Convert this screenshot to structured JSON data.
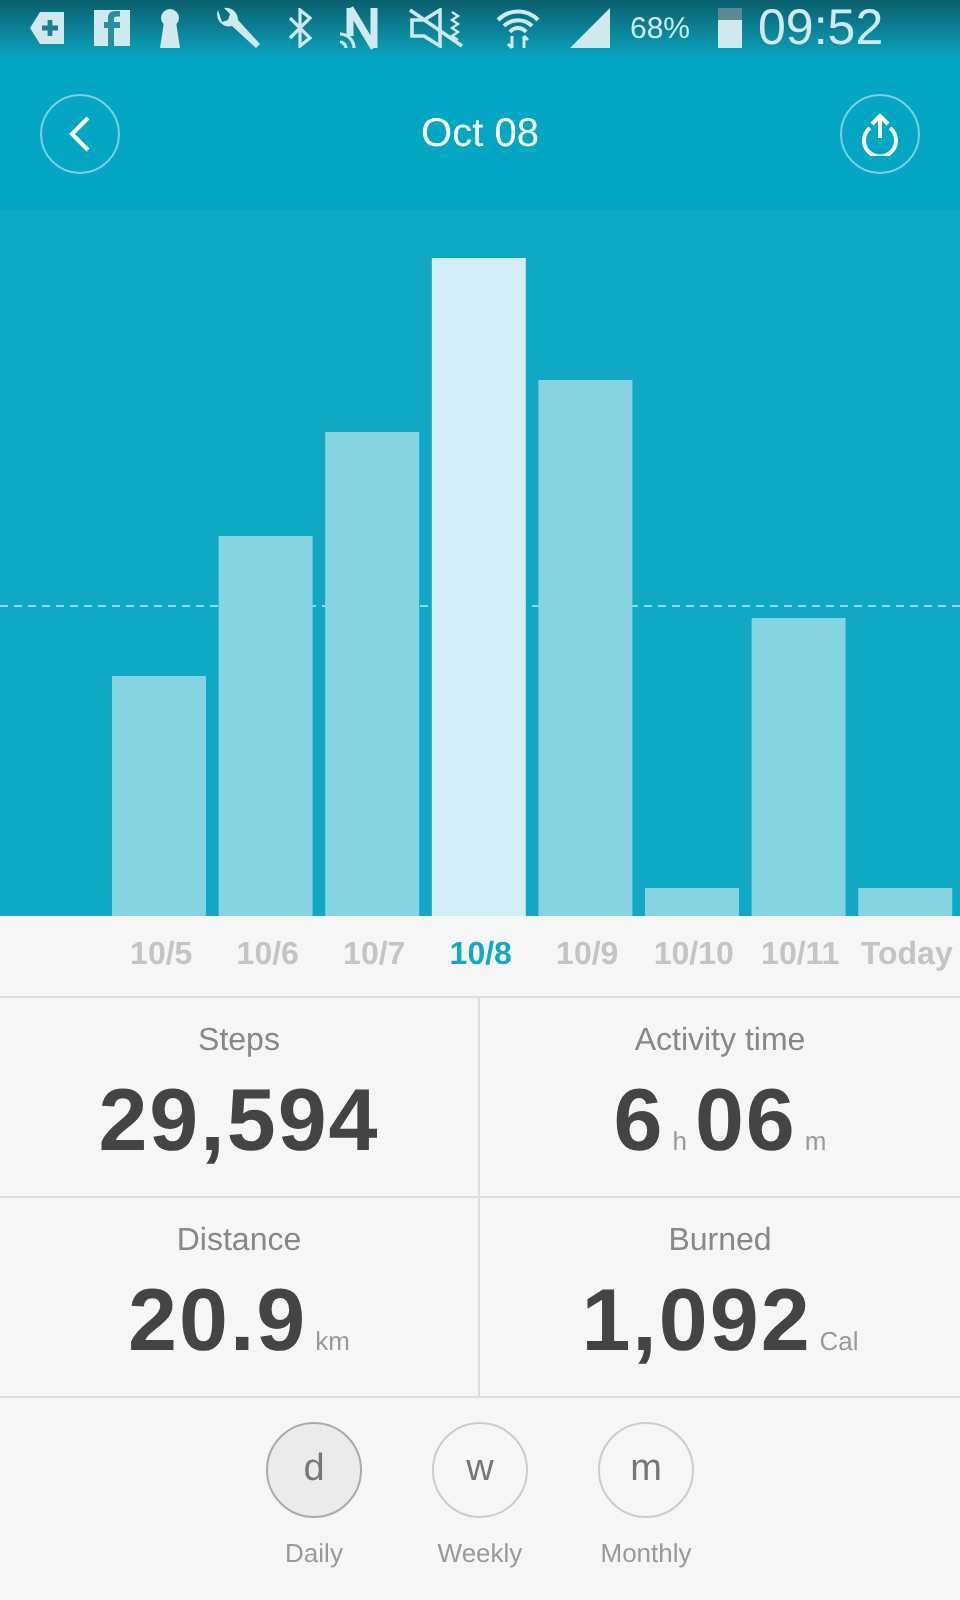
{
  "status_bar": {
    "battery": "68%",
    "time": "09:52"
  },
  "header": {
    "title": "Oct 08"
  },
  "days": [
    {
      "label": "10/5",
      "selected": false
    },
    {
      "label": "10/6",
      "selected": false
    },
    {
      "label": "10/7",
      "selected": false
    },
    {
      "label": "10/8",
      "selected": true
    },
    {
      "label": "10/9",
      "selected": false
    },
    {
      "label": "10/10",
      "selected": false
    },
    {
      "label": "10/11",
      "selected": false
    },
    {
      "label": "Today",
      "selected": false
    }
  ],
  "stats": [
    {
      "label": "Steps",
      "parts": [
        {
          "kind": "number",
          "text": "29,594"
        }
      ]
    },
    {
      "label": "Activity time",
      "parts": [
        {
          "kind": "number",
          "text": "6"
        },
        {
          "kind": "unit",
          "text": "h"
        },
        {
          "kind": "number",
          "text": "06"
        },
        {
          "kind": "unit",
          "text": "m"
        }
      ]
    },
    {
      "label": "Distance",
      "parts": [
        {
          "kind": "number",
          "text": "20.9"
        },
        {
          "kind": "unit",
          "text": "km"
        }
      ]
    },
    {
      "label": "Burned",
      "parts": [
        {
          "kind": "number",
          "text": "1,092"
        },
        {
          "kind": "unit",
          "text": "Cal"
        }
      ]
    }
  ],
  "periods": [
    {
      "letter": "d",
      "label": "Daily",
      "selected": true
    },
    {
      "letter": "w",
      "label": "Weekly",
      "selected": false
    },
    {
      "letter": "m",
      "label": "Monthly",
      "selected": false
    }
  ]
}
